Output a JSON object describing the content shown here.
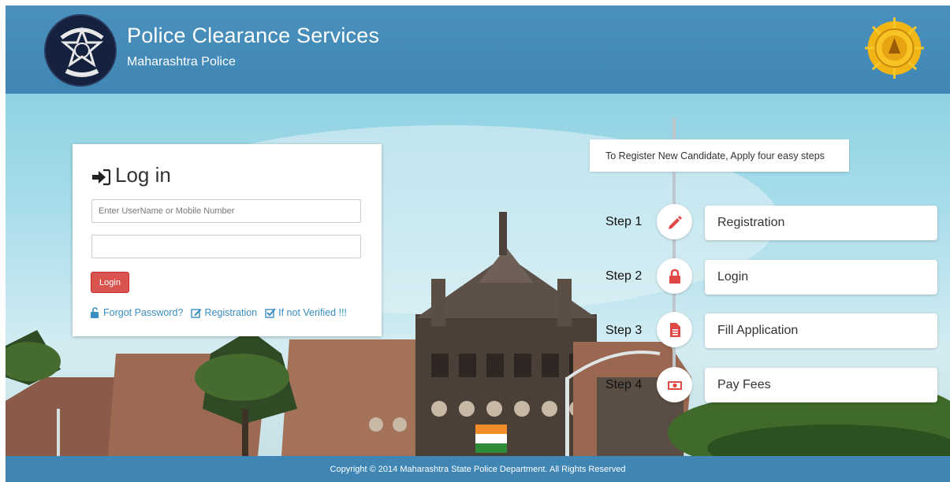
{
  "header": {
    "title": "Police Clearance Services",
    "subtitle": "Maharashtra Police",
    "logo_icon": "maharashtra-police-badge-icon",
    "emblem_icon": "maharashtra-govt-seal-icon"
  },
  "login": {
    "heading": "Log in",
    "heading_icon": "sign-in-icon",
    "username_placeholder": "Enter UserName or Mobile Number",
    "password_value": "",
    "login_button": "Login",
    "links": [
      {
        "label": "Forgot Password?",
        "icon": "unlock-icon"
      },
      {
        "label": "Registration",
        "icon": "edit-icon"
      },
      {
        "label": "If not Verified !!!",
        "icon": "check-square-icon"
      }
    ]
  },
  "steps": {
    "intro": "To Register New Candidate, Apply four easy steps",
    "items": [
      {
        "step": "Step 1",
        "label": "Registration",
        "icon": "pencil-icon"
      },
      {
        "step": "Step 2",
        "label": "Login",
        "icon": "lock-icon"
      },
      {
        "step": "Step 3",
        "label": "Fill Application",
        "icon": "document-icon"
      },
      {
        "step": "Step 4",
        "label": "Pay Fees",
        "icon": "money-icon"
      }
    ]
  },
  "footer": {
    "copyright": "Copyright © 2014 Maharashtra State Police Department. All Rights Reserved"
  },
  "colors": {
    "header_blue": "#3f86b4",
    "step_icon_red": "#e04848",
    "login_button_red": "#d9534f",
    "link_blue": "#3a8ec0"
  }
}
